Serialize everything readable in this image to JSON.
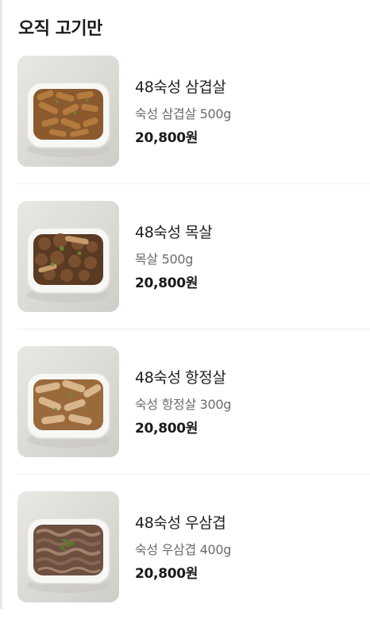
{
  "section": {
    "title": "오직 고기만"
  },
  "items": [
    {
      "name": "48숙성 삼겹살",
      "desc": "숙성 삼겹살 500g",
      "price": "20,800원",
      "image_icon": "pork-belly-dish-icon"
    },
    {
      "name": "48숙성 목살",
      "desc": "목살 500g",
      "price": "20,800원",
      "image_icon": "pork-neck-dish-icon"
    },
    {
      "name": "48숙성 항정살",
      "desc": "숙성 항정살 300g",
      "price": "20,800원",
      "image_icon": "pork-jowl-dish-icon"
    },
    {
      "name": "48숙성 우삼겹",
      "desc": "숙성 우삼겹 400g",
      "price": "20,800원",
      "image_icon": "beef-brisket-dish-icon"
    }
  ],
  "colors": {
    "price": "#1a1a1a",
    "desc": "#6b6b6b",
    "divider": "#f0f0f0"
  }
}
